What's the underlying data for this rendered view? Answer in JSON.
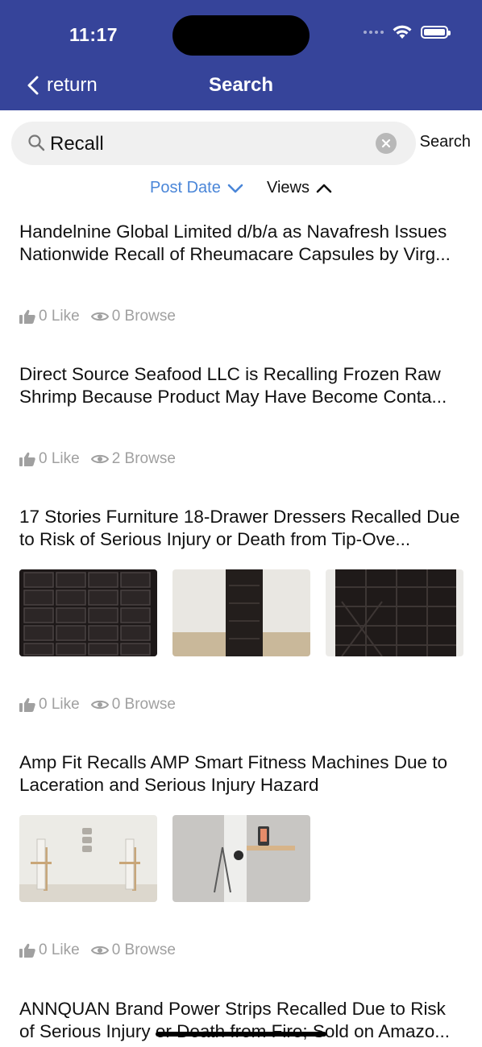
{
  "status": {
    "time": "11:17"
  },
  "nav": {
    "back_label": "return",
    "title": "Search"
  },
  "search": {
    "value": "Recall",
    "button_label": "Search"
  },
  "sort": {
    "post_date_label": "Post Date",
    "views_label": "Views"
  },
  "posts": [
    {
      "title": "Handelnine Global Limited d/b/a as Navafresh Issues Nationwide Recall of Rheumacare Capsules by Virg...",
      "likes": "0 Like",
      "browse": "0 Browse"
    },
    {
      "title": "Direct Source Seafood LLC is Recalling Frozen Raw Shrimp Because Product May Have Become Conta...",
      "likes": "0 Like",
      "browse": "2 Browse"
    },
    {
      "title": "17 Stories Furniture 18-Drawer Dressers Recalled Due to Risk of Serious Injury or Death from Tip-Ove...",
      "likes": "0 Like",
      "browse": "0 Browse"
    },
    {
      "title": "Amp Fit Recalls AMP Smart Fitness Machines Due to Laceration and Serious Injury Hazard",
      "likes": "0 Like",
      "browse": "0 Browse"
    },
    {
      "title": "ANNQUAN Brand Power Strips Recalled Due to Risk of Serious Injury or Death from Fire; Sold on Amazo..."
    }
  ],
  "colors": {
    "header_bg": "#36449a",
    "active_sort": "#4a86d8",
    "meta_text": "#a0a0a0"
  }
}
